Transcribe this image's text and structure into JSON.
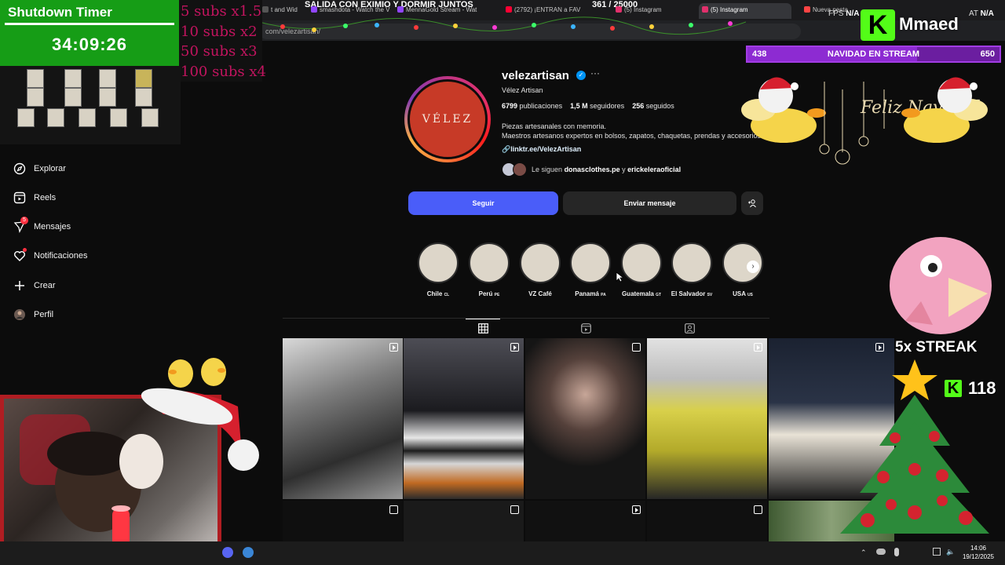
{
  "browser": {
    "stream_title": "SALIDA CON EXIMIO Y DORMIR JUNTOS",
    "viewer_count": "361 / 25000",
    "tabs": [
      {
        "label": "t and Wid",
        "color": "#555555"
      },
      {
        "label": "smashdota - Watch the V",
        "color": "#9146ff"
      },
      {
        "label": "MennaGold Stream - Wat",
        "color": "#9146ff"
      },
      {
        "label": "(2792) ¡ENTRAN a FAV",
        "color": "#ff0033"
      },
      {
        "label": "(5) Instagram",
        "color": "#e1306c"
      },
      {
        "label": "(5) Instagram",
        "color": "#e1306c"
      },
      {
        "label": "Nueva pestaña",
        "color": "#ff4444"
      }
    ],
    "address": "com/velezartisan/",
    "fps_label": "FPS",
    "fps_value": "N/A",
    "cpu_label": "AT",
    "cpu_value": "N/A"
  },
  "timer": {
    "title": "Shutdown Timer",
    "value": "34:09:26"
  },
  "subs": [
    "5 subs x1.5",
    "10 subs x2",
    "50 subs x3",
    "100 subs x4"
  ],
  "nav": {
    "items": [
      {
        "label": "Explorar",
        "icon": "compass-icon"
      },
      {
        "label": "Reels",
        "icon": "reels-icon"
      },
      {
        "label": "Mensajes",
        "icon": "messenger-icon",
        "badge": "5"
      },
      {
        "label": "Notificaciones",
        "icon": "heart-icon"
      },
      {
        "label": "Crear",
        "icon": "plus-icon"
      },
      {
        "label": "Perfil",
        "icon": "avatar-icon"
      }
    ]
  },
  "profile": {
    "avatar_text": "VÉLEZ",
    "username": "velezartisan",
    "verified": "✓",
    "more": "···",
    "fullname": "Vélez Artisan",
    "stats": {
      "posts_value": "6799",
      "posts_label": "publicaciones",
      "followers_value": "1,5 M",
      "followers_label": "seguidores",
      "following_value": "256",
      "following_label": "seguidos"
    },
    "bio_line1": "Piezas artesanales con memoria.",
    "bio_line2": "Maestros artesanos expertos en bolsos, zapatos, chaquetas, prendas y accesorios.",
    "link": "linktr.ee/VelezArtisan",
    "followed_by_prefix": "Le siguen",
    "followed_by_user1": "donasclothes.pe",
    "followed_by_and": "y",
    "followed_by_user2": "erickeleraoficial",
    "follow_button": "Seguir",
    "message_button": "Enviar mensaje",
    "adduser_button": "+",
    "highlights": [
      {
        "label": "Chile",
        "code": "CL"
      },
      {
        "label": "Perú",
        "code": "PE"
      },
      {
        "label": "VZ Café",
        "code": ""
      },
      {
        "label": "Panamá",
        "code": "PA"
      },
      {
        "label": "Guatemala",
        "code": "GT"
      },
      {
        "label": "El Salvador",
        "code": "SV"
      },
      {
        "label": "USA",
        "code": "US"
      }
    ],
    "highlight_next": "›"
  },
  "overlay": {
    "brand": "Mmaed",
    "brand_logo": "K",
    "goal_left": "438",
    "goal_title": "NAVIDAD EN STREAM",
    "goal_right": "650",
    "goal_progress": 0.674,
    "streak": "5x STREAK",
    "kick_logo": "K",
    "kick_count": "118",
    "feliz_text": "Feliz Navidad"
  },
  "taskbar": {
    "time": "14:06",
    "date": "19/12/2025"
  }
}
